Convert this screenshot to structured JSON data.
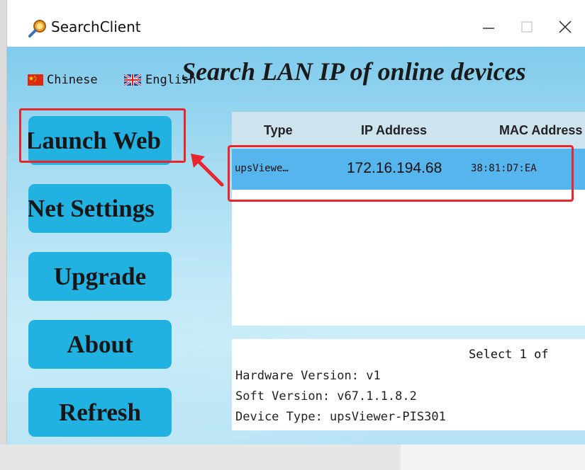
{
  "window": {
    "title": "SearchClient",
    "controls": {
      "minimize": "—",
      "maximize": "□",
      "close": "✕"
    }
  },
  "languages": [
    {
      "label": "Chinese",
      "flag": "china-flag-icon"
    },
    {
      "label": "English",
      "flag": "uk-flag-icon"
    }
  ],
  "headline": "Search LAN IP of online devices",
  "sidebar": {
    "buttons": [
      {
        "label": "Launch Web"
      },
      {
        "label": "Net Settings"
      },
      {
        "label": "Upgrade"
      },
      {
        "label": "About"
      },
      {
        "label": "Refresh"
      }
    ]
  },
  "device_table": {
    "columns": [
      "Type",
      "IP Address",
      "MAC Address"
    ],
    "rows": [
      {
        "type": "upsViewe…",
        "ip": "172.16.194.68",
        "mac": "38:81:D7:EA"
      }
    ]
  },
  "info": {
    "status": "Select 1 of",
    "hardware": "Hardware Version: v1",
    "software": "Soft Version: v67.1.1.8.2",
    "device_type": "Device Type: upsViewer-PIS301"
  },
  "colors": {
    "button": "#22b2e2",
    "selected_row": "#57b5ee",
    "highlight": "#e8262c",
    "table_header": "#cde3ee"
  }
}
